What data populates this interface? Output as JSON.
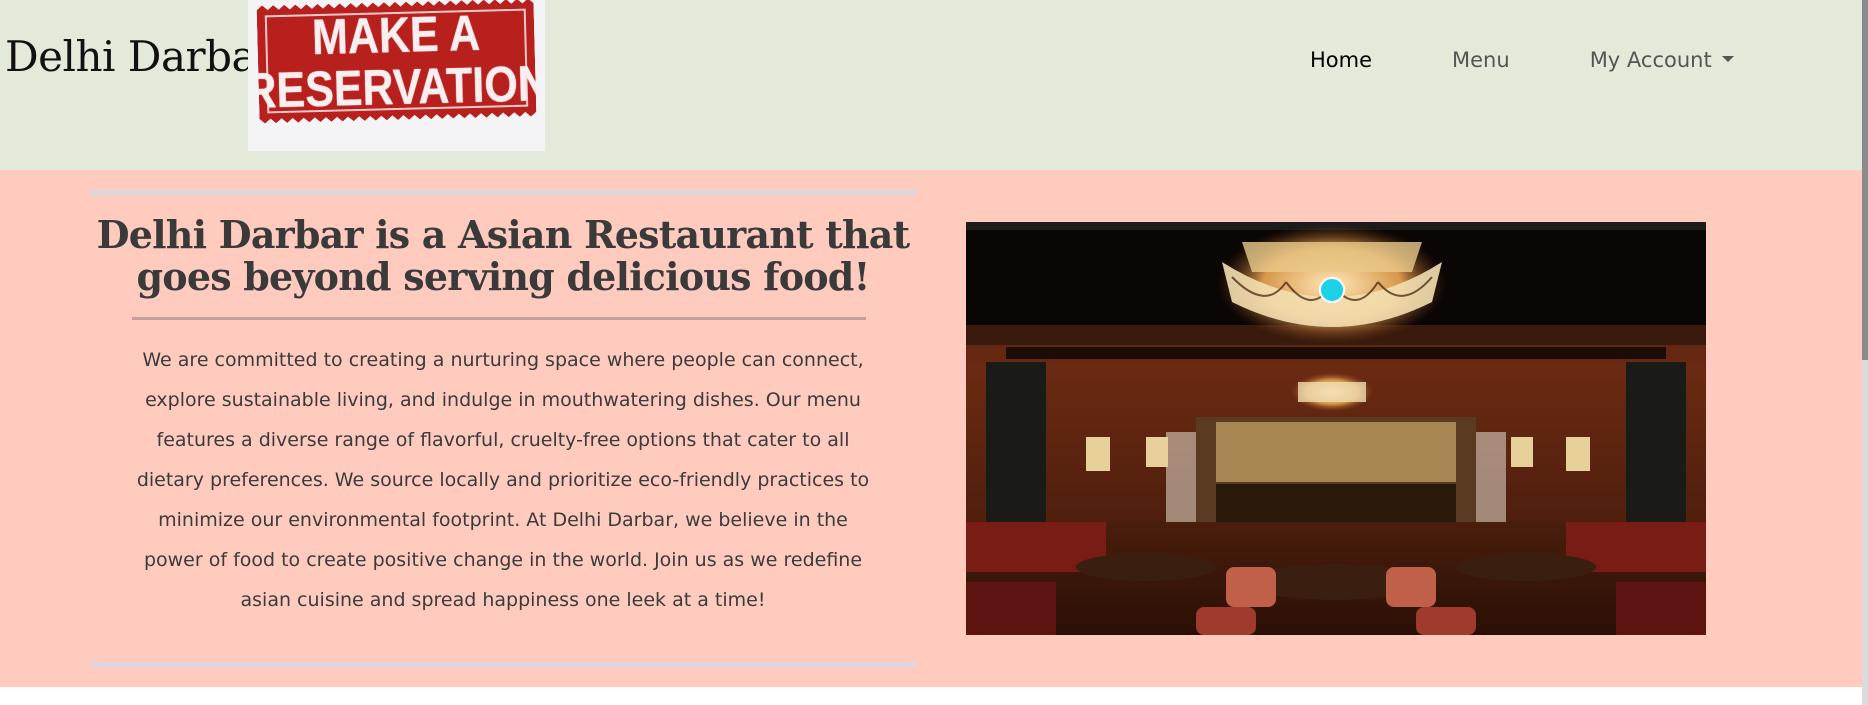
{
  "navbar": {
    "brand": "Delhi Darbar",
    "reservation_line1": "MAKE A",
    "reservation_line2": "RESERVATION",
    "links": [
      {
        "label": "Home",
        "active": true
      },
      {
        "label": "Menu",
        "active": false
      },
      {
        "label": "My Account",
        "active": false,
        "dropdown": true
      }
    ]
  },
  "hero": {
    "headline": "Delhi Darbar is a Asian Restaurant that goes beyond serving delicious food!",
    "body": "We are committed to creating a nurturing space where people can connect, explore sustainable living, and indulge in mouthwatering dishes. Our menu features a diverse range of flavorful, cruelty-free options that cater to all dietary preferences. We source locally and prioritize eco-friendly practices to minimize our environmental footprint. At Delhi Darbar, we believe in the power of food to create positive change in the world. Join us as we redefine asian cuisine and spread happiness one leek at a time!"
  },
  "colors": {
    "navbar_bg": "#e4ead9",
    "hero_bg": "#ffcbbf",
    "stamp_red": "#b8201e",
    "cursor_marker": "#1ad3e6"
  },
  "icons": {
    "dropdown": "caret-down-icon"
  }
}
